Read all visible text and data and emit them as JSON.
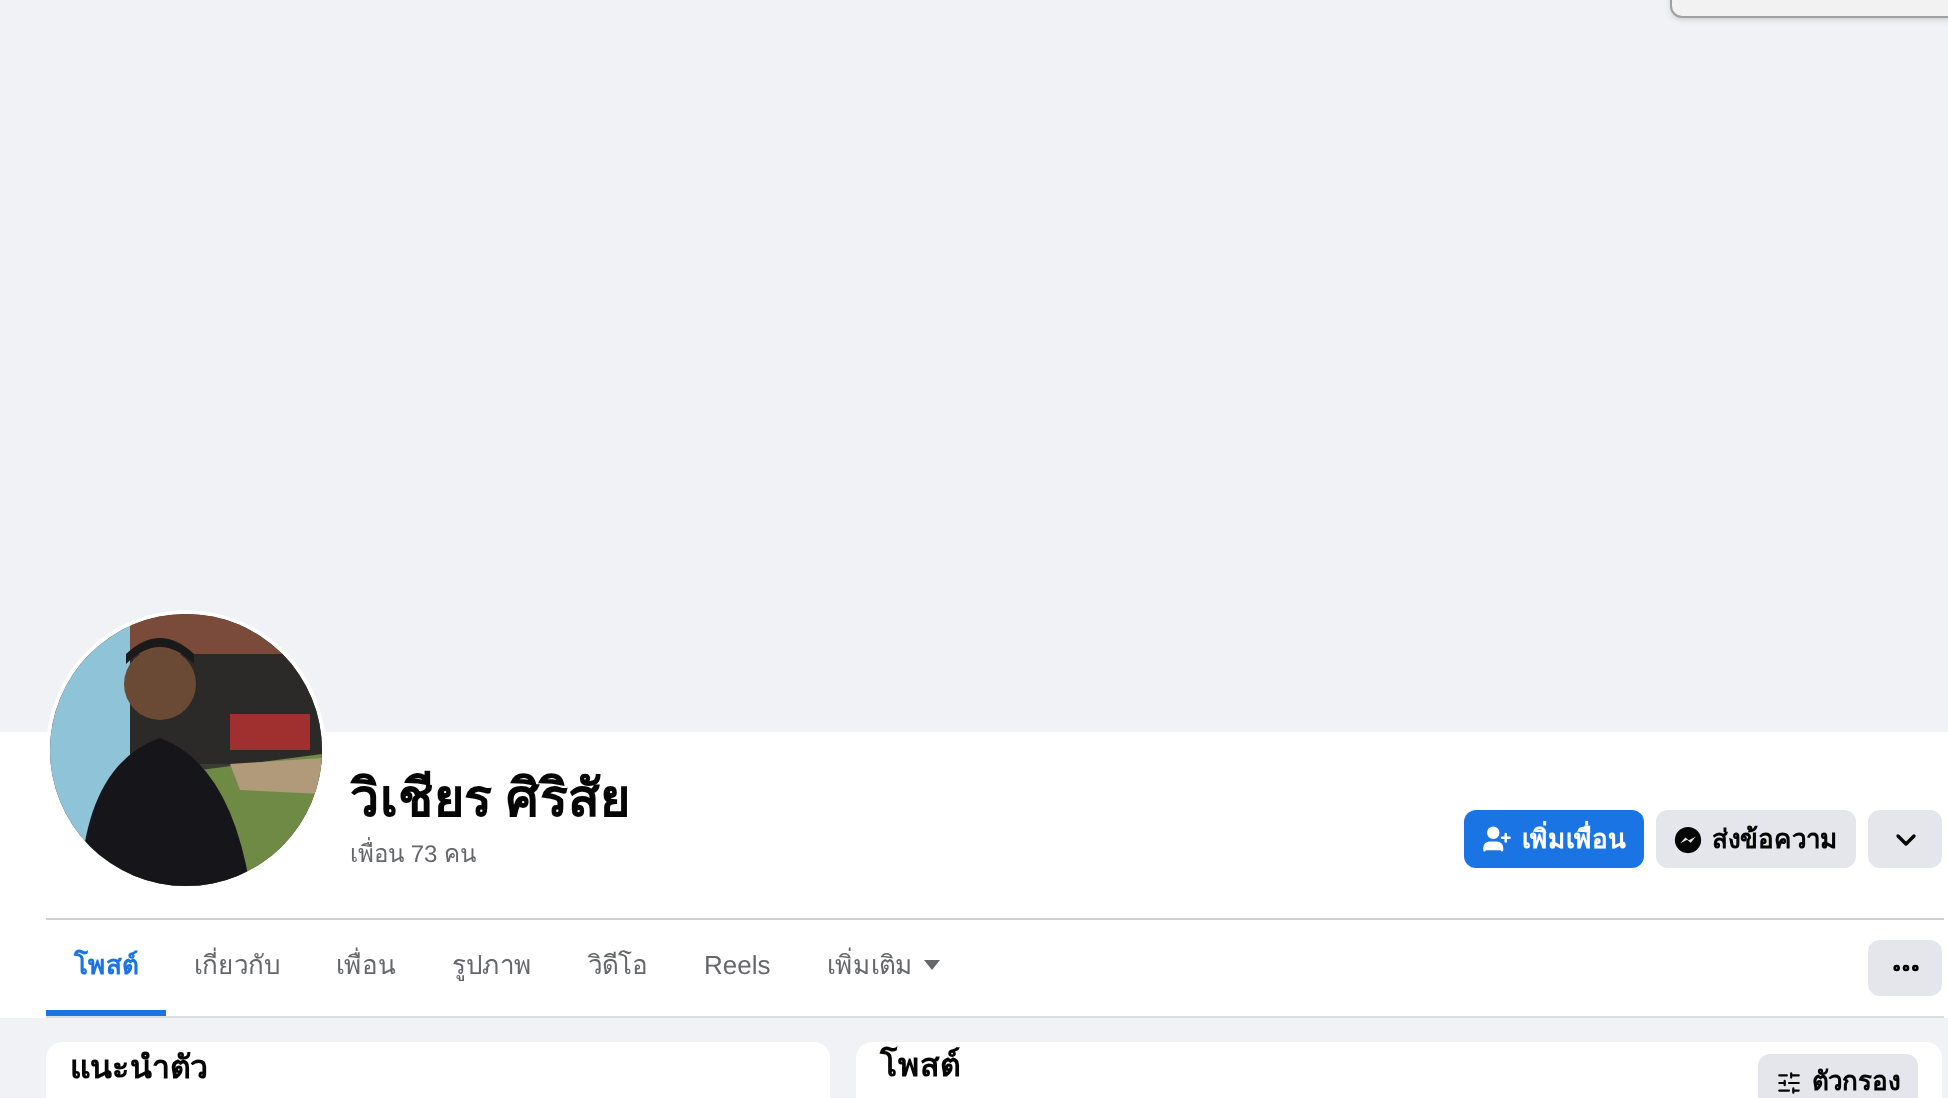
{
  "profile": {
    "name": "วิเชียร ศิริสัย",
    "friends": "เพื่อน 73 คน"
  },
  "actions": [
    {
      "kind": "primary",
      "label": "เพิ่มเพื่อน"
    },
    {
      "kind": "secondary",
      "label": "ส่งข้อความ"
    },
    {
      "kind": "menu"
    }
  ],
  "tabs": [
    {
      "label": "โพสต์",
      "selected": true,
      "kind": "tab"
    },
    {
      "label": "เกี่ยวกับ",
      "selected": false,
      "kind": "tab"
    },
    {
      "label": "เพื่อน",
      "selected": false,
      "kind": "tab"
    },
    {
      "label": "รูปภาพ",
      "selected": false,
      "kind": "tab"
    },
    {
      "label": "วิดีโอ",
      "selected": false,
      "kind": "tab"
    },
    {
      "label": "Reels",
      "selected": false,
      "kind": "tab"
    },
    {
      "label": "เพิ่มเติม",
      "selected": false,
      "kind": "dropdown"
    }
  ],
  "intro_card": {
    "title": "แนะนำตัว"
  },
  "posts_card": {
    "title": "โพสต์",
    "filter_button": "ตัวกรอง"
  }
}
